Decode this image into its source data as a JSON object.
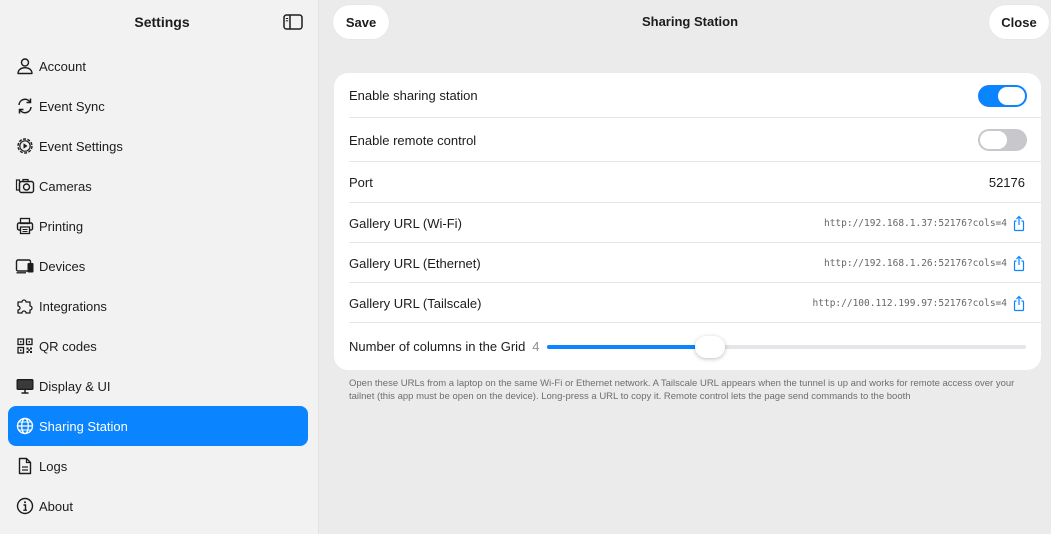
{
  "sidebar": {
    "title": "Settings",
    "items": [
      {
        "label": "Account",
        "icon": "person-icon"
      },
      {
        "label": "Event Sync",
        "icon": "sync-icon"
      },
      {
        "label": "Event Settings",
        "icon": "gear-icon"
      },
      {
        "label": "Cameras",
        "icon": "camera-icon"
      },
      {
        "label": "Printing",
        "icon": "printer-icon"
      },
      {
        "label": "Devices",
        "icon": "devices-icon"
      },
      {
        "label": "Integrations",
        "icon": "puzzle-icon"
      },
      {
        "label": "QR codes",
        "icon": "qr-code-icon"
      },
      {
        "label": "Display & UI",
        "icon": "display-icon"
      },
      {
        "label": "Sharing Station",
        "icon": "globe-icon",
        "active": true
      },
      {
        "label": "Logs",
        "icon": "document-icon"
      },
      {
        "label": "About",
        "icon": "info-icon"
      }
    ]
  },
  "header": {
    "title": "Sharing Station",
    "save_label": "Save",
    "close_label": "Close"
  },
  "settings": {
    "enable_sharing": {
      "label": "Enable sharing station",
      "on": true
    },
    "enable_remote": {
      "label": "Enable remote control",
      "on": false
    },
    "port": {
      "label": "Port",
      "value": "52176"
    },
    "urls": [
      {
        "label": "Gallery URL (Wi-Fi)",
        "value": "http://192.168.1.37:52176?cols=4"
      },
      {
        "label": "Gallery URL (Ethernet)",
        "value": "http://192.168.1.26:52176?cols=4"
      },
      {
        "label": "Gallery URL (Tailscale)",
        "value": "http://100.112.199.97:52176?cols=4"
      }
    ],
    "columns": {
      "label": "Number of columns in the Grid",
      "value": "4",
      "fraction": 0.34
    }
  },
  "footnote": "Open these URLs from a laptop on the same Wi-Fi or Ethernet network. A Tailscale URL appears when the tunnel is up and works for remote access over your tailnet (this app must be open on the device). Long-press a URL to copy it. Remote control lets the page send commands to the booth",
  "colors": {
    "accent": "#0a84ff",
    "background": "#ebebeb",
    "sidebar": "#f2f2f2"
  }
}
